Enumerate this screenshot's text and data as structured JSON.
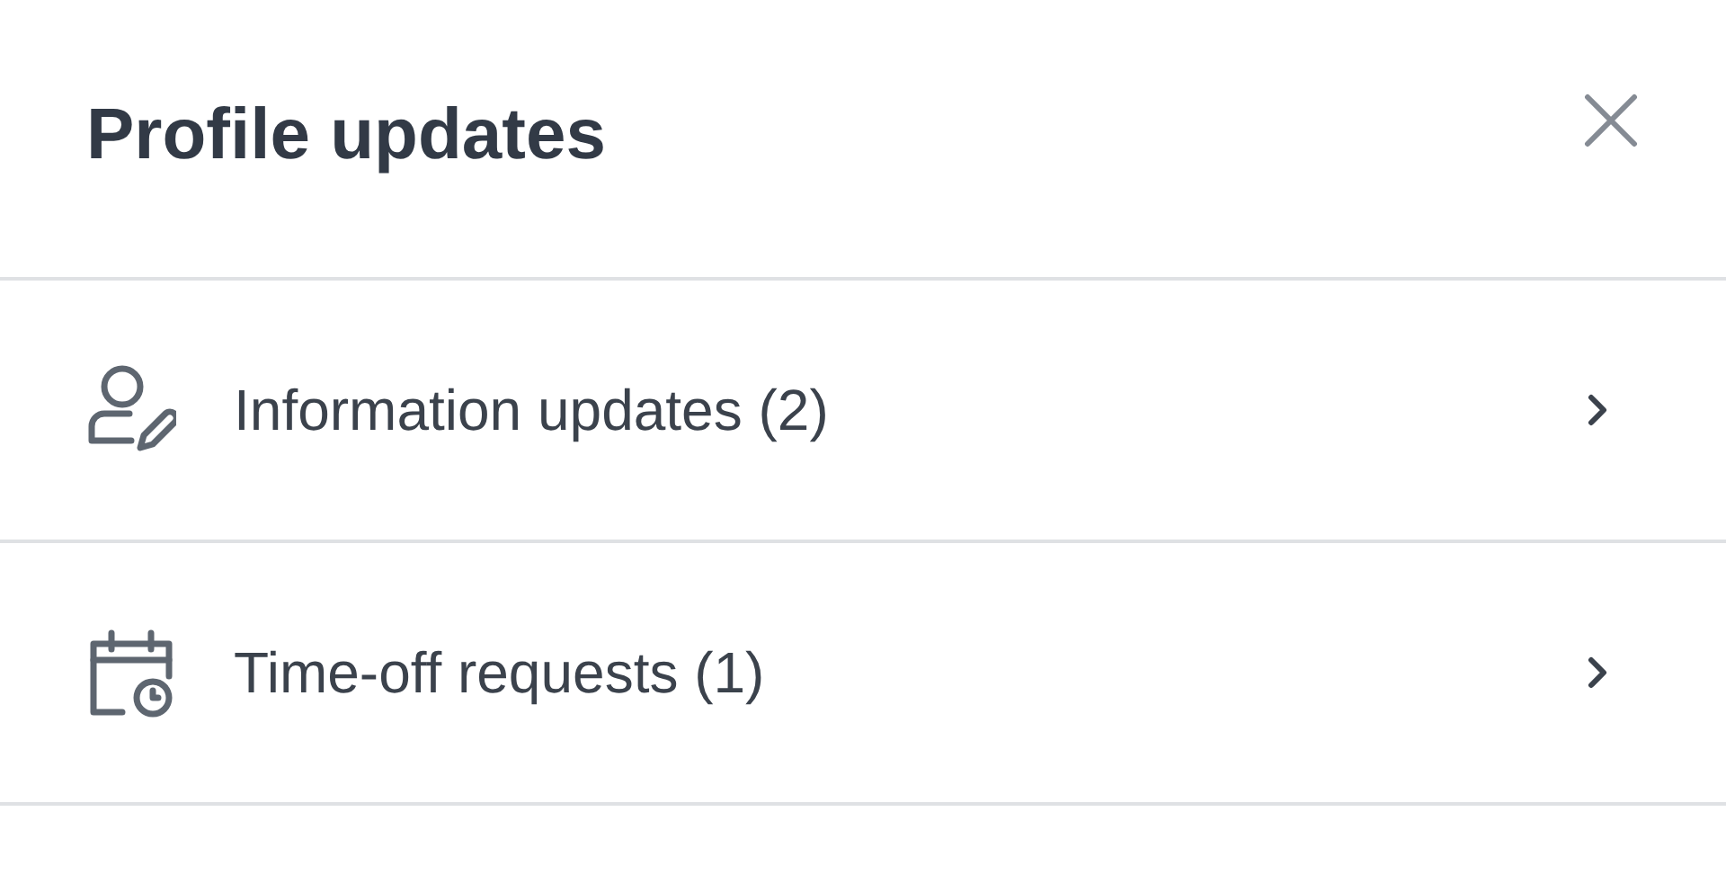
{
  "header": {
    "title": "Profile updates"
  },
  "items": [
    {
      "kind": "person",
      "label": "Information updates (2)"
    },
    {
      "kind": "calendar",
      "label": "Time-off requests (1)"
    }
  ]
}
